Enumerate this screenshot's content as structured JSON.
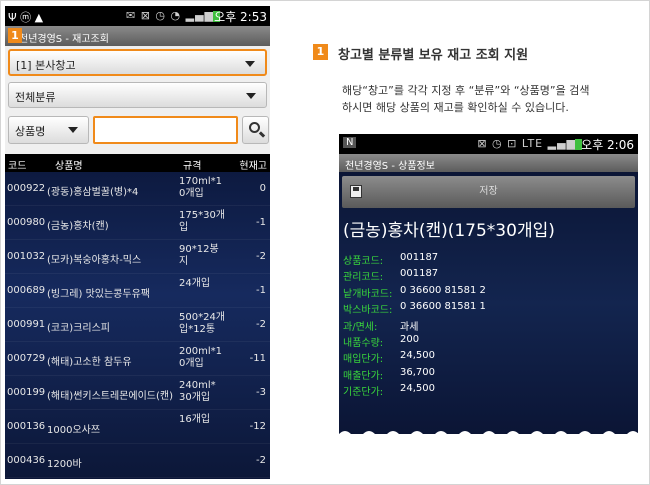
{
  "left_phone": {
    "status_time": "오후 2:53",
    "title": "천년경영S - 재고조회",
    "badge": "1",
    "warehouse_select": "[1] 본사창고",
    "category_select": "전체분류",
    "search_type_select": "상품명",
    "search_value": "",
    "table": {
      "headers": {
        "code": "코드",
        "name": "상품명",
        "spec": "규격",
        "stock": "현재고"
      },
      "rows": [
        {
          "code": "000922",
          "name": "(광동)홍삼벌꿀(병)*4",
          "spec": "170ml*1\n0개입",
          "stock": "0"
        },
        {
          "code": "000980",
          "name": "(금농)홍차(캔)",
          "spec": "175*30개\n입",
          "stock": "-1"
        },
        {
          "code": "001032",
          "name": "(모카)복숭아홍차-믹스",
          "spec": "90*12봉\n지",
          "stock": "-2"
        },
        {
          "code": "000689",
          "name": "(빙그레) 맛있는콩두유팩",
          "spec": "24개입",
          "stock": "-1"
        },
        {
          "code": "000991",
          "name": "(코코)크리스피",
          "spec": "500*24개\n입*12통",
          "stock": "-2"
        },
        {
          "code": "000729",
          "name": "(해태)고소한 참두유",
          "spec": "200ml*1\n0개입",
          "stock": "-11"
        },
        {
          "code": "000199",
          "name": "(해태)썬키스트레몬에이드(캔)",
          "spec": "240ml*\n30개입",
          "stock": "-3"
        },
        {
          "code": "000136",
          "name": "1000오사쯔",
          "spec": "16개입",
          "stock": "-12"
        },
        {
          "code": "000436",
          "name": "1200바",
          "spec": "",
          "stock": "-2"
        }
      ]
    }
  },
  "right_panel": {
    "badge": "1",
    "title": "창고별 분류별 보유 재고 조회 지원",
    "description_line1": "해당“창고”를 각각 지정 후 “분류”와 “상품명”을 검색",
    "description_line2": "하시면 해당 상품의 재고를 확인하실 수 있습니다.",
    "phone": {
      "status_time": "오후 2:06",
      "title": "천년경영S - 상품정보",
      "save_label": "저장",
      "product_name": "(금농)홍차(캔)(175*30개입)",
      "fields": [
        {
          "label": "상품코드:",
          "value": "001187"
        },
        {
          "label": "관리코드:",
          "value": "001187"
        },
        {
          "label": "낱개바코드:",
          "value": "0 36600 81581 2"
        },
        {
          "label": "박스바코드:",
          "value": "0 36600 81581 1"
        },
        {
          "label": "과/면세:",
          "value": "과세"
        },
        {
          "label": "내품수량:",
          "value": "200"
        },
        {
          "label": "매입단가:",
          "value": "24,500"
        },
        {
          "label": "매출단가:",
          "value": "36,700"
        },
        {
          "label": "기준단가:",
          "value": "24,500"
        }
      ]
    }
  },
  "colors": {
    "accent": "#f08a1a",
    "label_green": "#39d63c",
    "list_bg": "#13254f"
  }
}
